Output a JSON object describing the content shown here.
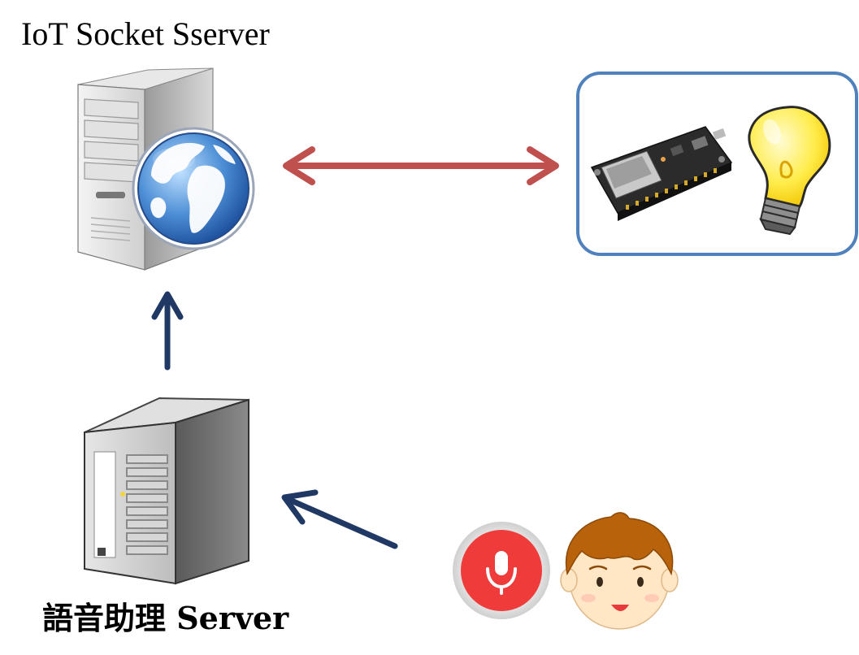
{
  "labels": {
    "iot_socket_server": "IoT Socket Sserver",
    "voice_assistant_server": "語音助理 Server"
  },
  "colors": {
    "bidirectional_arrow": "#c0504d",
    "flow_arrow": "#1f3864",
    "device_box_border": "#4f81bd",
    "mic_button": "#f03b3b",
    "bulb": "#ffe94a"
  },
  "icons": {
    "web_server": "server-globe-icon",
    "iot_device": "nodemcu-board-icon",
    "light": "light-bulb-icon",
    "microphone": "microphone-icon",
    "user": "user-face-icon",
    "voice_server": "server-tower-icon"
  }
}
